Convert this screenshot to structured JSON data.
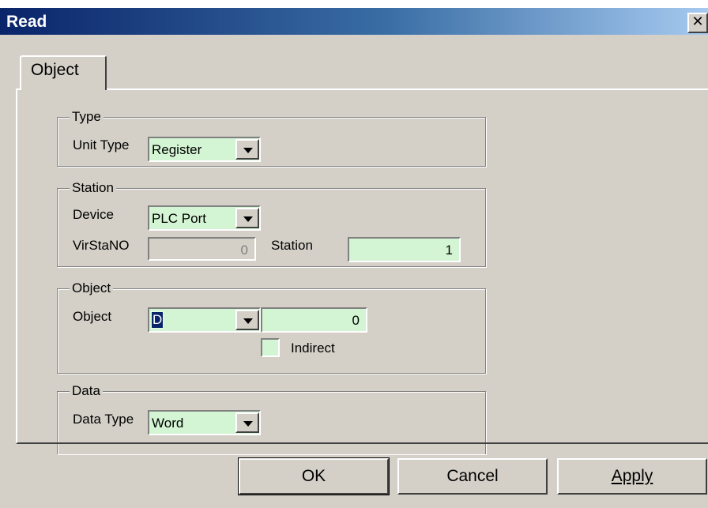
{
  "window": {
    "title": "Read",
    "close_glyph": "✕"
  },
  "tabs": [
    {
      "label": "Object"
    }
  ],
  "type_group": {
    "legend": "Type",
    "unit_type_label": "Unit Type",
    "unit_type_value": "Register"
  },
  "station_group": {
    "legend": "Station",
    "device_label": "Device",
    "device_value": "PLC Port",
    "virstano_label": "VirStaNO",
    "virstano_value": "0",
    "station_label": "Station",
    "station_value": "1"
  },
  "object_group": {
    "legend": "Object",
    "object_label": "Object",
    "object_value": "D",
    "address_value": "0",
    "indirect_label": "Indirect",
    "indirect_checked": false
  },
  "data_group": {
    "legend": "Data",
    "data_type_label": "Data Type",
    "data_type_value": "Word"
  },
  "buttons": {
    "ok": "OK",
    "cancel": "Cancel",
    "apply": "Apply"
  },
  "colors": {
    "field_green": "#d4f5d4",
    "dialog_face": "#d4d0c8",
    "title_start": "#0a246a",
    "title_end": "#a6caf0",
    "selection": "#0a246a"
  }
}
